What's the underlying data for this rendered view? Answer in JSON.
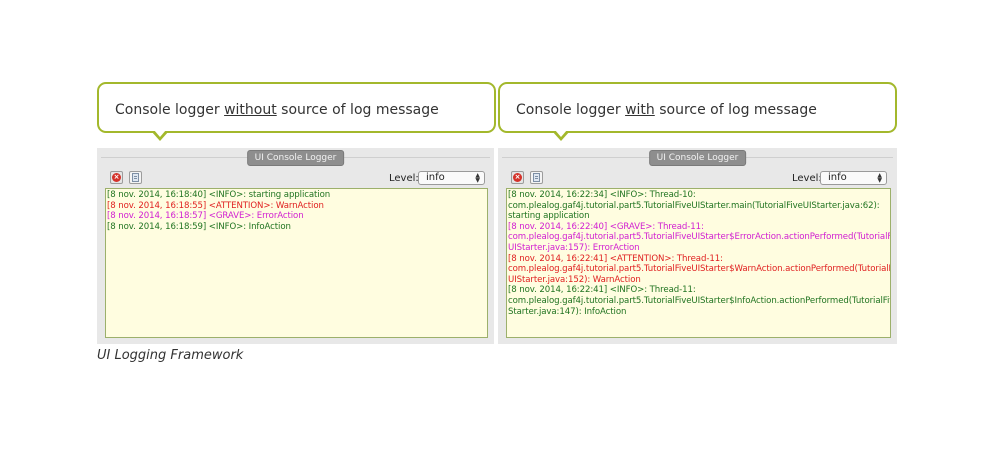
{
  "callouts": [
    {
      "before": "Console logger ",
      "emph": "without",
      "after": " source of log message"
    },
    {
      "before": "Console logger ",
      "emph": "with",
      "after": " source of log message"
    }
  ],
  "windows": [
    {
      "title": "UI Console Logger",
      "level_label": "Level:",
      "level_value": "info",
      "lines": [
        {
          "level": "info",
          "text": "[8 nov. 2014, 16:18:40] <INFO>: starting application"
        },
        {
          "level": "warn",
          "text": "[8 nov. 2014, 16:18:55] <ATTENTION>: WarnAction"
        },
        {
          "level": "err",
          "text": "[8 nov. 2014, 16:18:57] <GRAVE>: ErrorAction"
        },
        {
          "level": "info",
          "text": "[8 nov. 2014, 16:18:59] <INFO>: InfoAction"
        }
      ]
    },
    {
      "title": "UI Console Logger",
      "level_label": "Level:",
      "level_value": "info",
      "lines": [
        {
          "level": "info",
          "text": "[8 nov. 2014, 16:22:34] <INFO>: Thread-10:"
        },
        {
          "level": "info",
          "text": "com.plealog.gaf4j.tutorial.part5.TutorialFiveUIStarter.main(TutorialFiveUIStarter.java:62):"
        },
        {
          "level": "info",
          "text": "starting application"
        },
        {
          "level": "err",
          "text": "[8 nov. 2014, 16:22:40] <GRAVE>: Thread-11:"
        },
        {
          "level": "err",
          "text": "com.plealog.gaf4j.tutorial.part5.TutorialFiveUIStarter$ErrorAction.actionPerformed(TutorialFive"
        },
        {
          "level": "err",
          "text": "UIStarter.java:157): ErrorAction"
        },
        {
          "level": "warn",
          "text": "[8 nov. 2014, 16:22:41] <ATTENTION>: Thread-11:"
        },
        {
          "level": "warn",
          "text": "com.plealog.gaf4j.tutorial.part5.TutorialFiveUIStarter$WarnAction.actionPerformed(TutorialFive"
        },
        {
          "level": "warn",
          "text": "UIStarter.java:152): WarnAction"
        },
        {
          "level": "info",
          "text": "[8 nov. 2014, 16:22:41] <INFO>: Thread-11:"
        },
        {
          "level": "info",
          "text": "com.plealog.gaf4j.tutorial.part5.TutorialFiveUIStarter$InfoAction.actionPerformed(TutorialFiveUI"
        },
        {
          "level": "info",
          "text": "Starter.java:147): InfoAction"
        }
      ]
    }
  ],
  "icons": {
    "clear": "stop-icon",
    "copy": "clipboard-icon"
  },
  "colors": {
    "accent": "#a3b82c",
    "info": "#217421",
    "warn": "#e01f1f",
    "error": "#d11ed1",
    "log_bg": "#fffde0"
  },
  "caption": "UI Logging Framework"
}
